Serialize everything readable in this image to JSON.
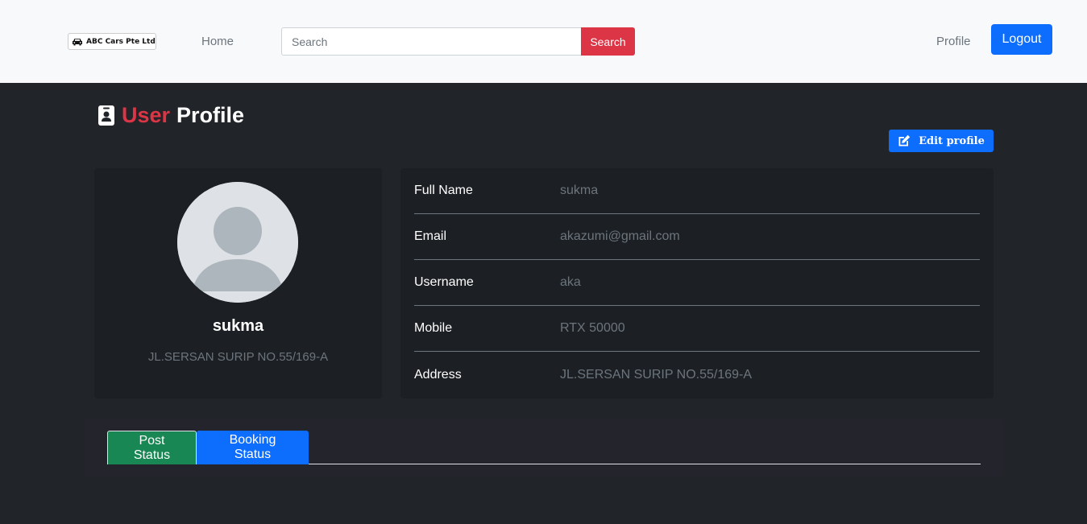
{
  "navbar": {
    "brand_label": "ABC Cars Pte Ltd",
    "home_label": "Home",
    "search_placeholder": "Search",
    "search_button": "Search",
    "profile_label": "Profile",
    "logout_button": "Logout"
  },
  "page": {
    "title_accent": "User",
    "title_rest": "Profile",
    "edit_button": "Edit profile"
  },
  "profile_card": {
    "name": "sukma",
    "address": "JL.SERSAN SURIP NO.55/169-A"
  },
  "details": [
    {
      "label": "Full Name",
      "value": "sukma"
    },
    {
      "label": "Email",
      "value": "akazumi@gmail.com"
    },
    {
      "label": "Username",
      "value": "aka"
    },
    {
      "label": "Mobile",
      "value": "RTX 50000"
    },
    {
      "label": "Address",
      "value": "JL.SERSAN SURIP NO.55/169-A"
    }
  ],
  "tabs": [
    {
      "label": "Post Status"
    },
    {
      "label": "Booking Status"
    }
  ],
  "colors": {
    "accent_red": "#dc3545",
    "primary_blue": "#0d6efd",
    "success_green": "#198754",
    "background": "#212529"
  },
  "icons": {
    "brand": "car-icon",
    "title": "id-badge-icon",
    "edit": "edit-icon",
    "avatar": "user-avatar-icon"
  }
}
